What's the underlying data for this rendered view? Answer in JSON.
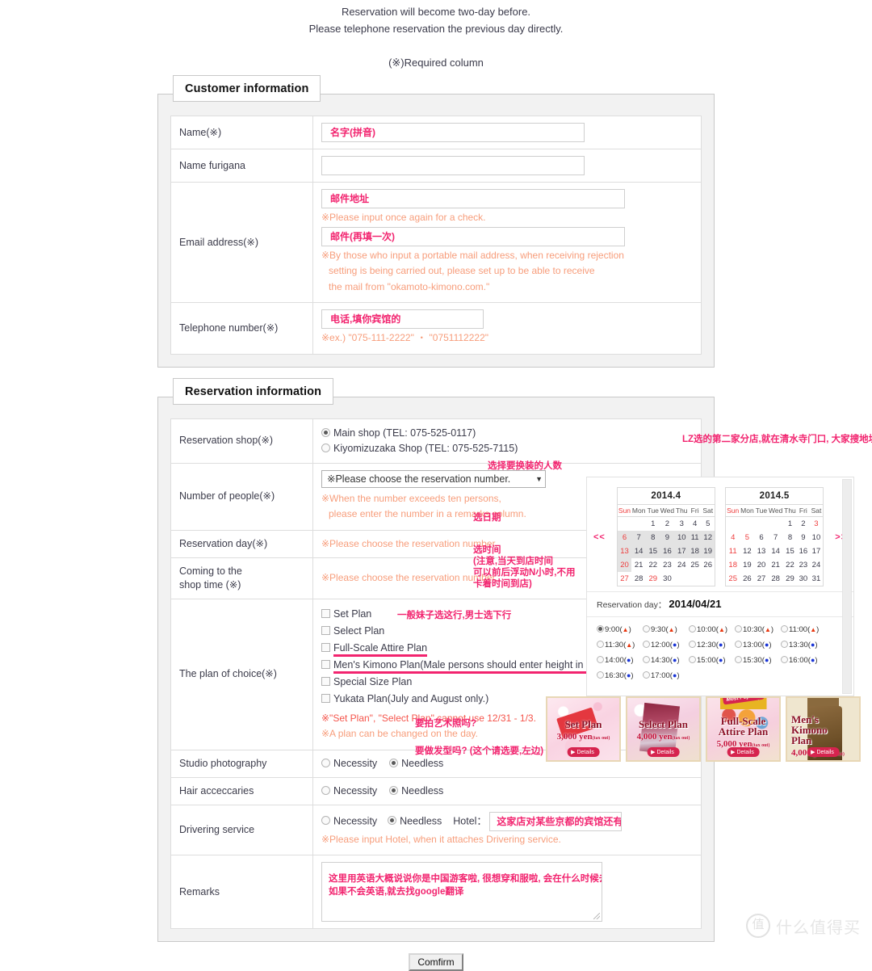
{
  "intro": {
    "line1": "Reservation will become two-day before.",
    "line2": "Please telephone reservation the previous day directly.",
    "required": "(※)Required column"
  },
  "customer_panel": {
    "title": "Customer information",
    "rows": {
      "name_label": "Name(※)",
      "name_value": "名字(拼音)",
      "furigana_label": "Name furigana",
      "furigana_value": "",
      "email_label": "Email address(※)",
      "email_value": "邮件地址",
      "email_check_note": "※Please input once again for a check.",
      "email_confirm_value": "邮件(再填一次)",
      "email_note_1": "※By those who input a portable mail address, when receiving rejection",
      "email_note_2": "setting is being carried out, please set up to be able to receive",
      "email_note_3": "the mail from \"okamoto-kimono.com.\"",
      "tel_label": "Telephone number(※)",
      "tel_value": "电话,填你宾馆的",
      "tel_note": "※ex.)  \"075-111-2222\" ・ \"0751112222\""
    }
  },
  "reservation_panel": {
    "title": "Reservation information",
    "shop": {
      "label": "Reservation shop(※)",
      "option_main": "Main shop (TEL: 075-525-0117)",
      "option_kiyomizu": "Kiyomizuzaka Shop (TEL: 075-525-7115)",
      "annotation": "LZ选的第二家分店,就在清水寺门口, 大家搜地址就在google地图上搜号码就行"
    },
    "people": {
      "label": "Number of people(※)",
      "select_value": "※Please choose the reservation number.",
      "annotation": "选择要换装的人数",
      "note_1": "※When the number exceeds ten persons,",
      "note_2": "please enter the number in a remarks column."
    },
    "day": {
      "label": "Reservation day(※)",
      "note": "※Please choose the reservation number.",
      "annotation": "选日期"
    },
    "time": {
      "label_line1": "Coming to the",
      "label_line2": "shop time (※)",
      "note": "※Please choose the reservation number.",
      "annotation_1": "选时间",
      "annotation_2": "(注意,当天到店时间",
      "annotation_3": "可以前后浮动N小时,不用",
      "annotation_4": "卡着时间到店)"
    },
    "plan": {
      "label": "The plan of choice(※)",
      "items": [
        {
          "text": "Set Plan",
          "underline": false
        },
        {
          "text": "Select Plan",
          "underline": false
        },
        {
          "text": "Full-Scale Attire Plan",
          "underline": true
        },
        {
          "text": "Men's Kimono Plan(Male persons should enter height in a rer",
          "underline": true
        },
        {
          "text": "Special Size Plan",
          "underline": false
        },
        {
          "text": "Yukata Plan(July and August only.)",
          "underline": false
        }
      ],
      "annotation": "一般妹子选这行,男士选下行",
      "note_1": "※\"Set Plan\", \"Select Plan\" cannot use 12/31 - 1/3.",
      "note_2": "※A plan can be changed on the day."
    },
    "studio": {
      "label": "Studio photography",
      "opt_necessity": "Necessity",
      "opt_needless": "Needless",
      "annotation": "要拍艺术照吗?"
    },
    "hair": {
      "label": "Hair acceccaries",
      "opt_necessity": "Necessity",
      "opt_needless": "Needless",
      "annotation": "要做发型吗? (这个请选要,左边)"
    },
    "driver": {
      "label": "Drivering service",
      "opt_necessity": "Necessity",
      "opt_needless": "Needless",
      "hotel_label": "Hotel：",
      "hotel_value": "这家店对某些京都的宾馆还有接送服务....大家可以不管, 这里不用选)",
      "note": "※Please input Hotel, when it attaches Drivering service."
    },
    "remarks": {
      "label": "Remarks",
      "value_line1": "这里用英语大概说说你是中国游客啦, 很想穿和服啦, 会在什么时候去日本然后会在哪天到店啦, 希望贵店接受你的预约啦....",
      "value_line2": "如果不会英语,就去找google翻译"
    }
  },
  "calendar": {
    "prev_label": "<<",
    "next_label": ">>",
    "dow": [
      "Sun",
      "Mon",
      "Tue",
      "Wed",
      "Thu",
      "Fri",
      "Sat"
    ],
    "months": [
      {
        "title": "2014.4",
        "weeks": [
          [
            {
              "d": ""
            },
            {
              "d": ""
            },
            {
              "d": "1"
            },
            {
              "d": "2"
            },
            {
              "d": "3"
            },
            {
              "d": "4"
            },
            {
              "d": "5"
            }
          ],
          [
            {
              "d": "6",
              "dim": true,
              "sun": true
            },
            {
              "d": "7",
              "dim": true
            },
            {
              "d": "8",
              "dim": true
            },
            {
              "d": "9",
              "dim": true
            },
            {
              "d": "10",
              "dim": true
            },
            {
              "d": "11",
              "dim": true
            },
            {
              "d": "12",
              "dim": true
            }
          ],
          [
            {
              "d": "13",
              "dim": true,
              "sun": true
            },
            {
              "d": "14",
              "dim": true
            },
            {
              "d": "15",
              "dim": true
            },
            {
              "d": "16",
              "dim": true
            },
            {
              "d": "17",
              "dim": true
            },
            {
              "d": "18",
              "dim": true
            },
            {
              "d": "19",
              "dim": true
            }
          ],
          [
            {
              "d": "20",
              "dim": true,
              "sun": true
            },
            {
              "d": "21"
            },
            {
              "d": "22"
            },
            {
              "d": "23"
            },
            {
              "d": "24"
            },
            {
              "d": "25"
            },
            {
              "d": "26"
            }
          ],
          [
            {
              "d": "27",
              "sun": true
            },
            {
              "d": "28"
            },
            {
              "d": "29",
              "sun": true
            },
            {
              "d": "30"
            },
            {
              "d": ""
            },
            {
              "d": ""
            },
            {
              "d": ""
            }
          ]
        ]
      },
      {
        "title": "2014.5",
        "weeks": [
          [
            {
              "d": ""
            },
            {
              "d": ""
            },
            {
              "d": ""
            },
            {
              "d": ""
            },
            {
              "d": "1"
            },
            {
              "d": "2"
            },
            {
              "d": "3",
              "sun": true
            }
          ],
          [
            {
              "d": "4",
              "sun": true
            },
            {
              "d": "5",
              "sun": true
            },
            {
              "d": "6"
            },
            {
              "d": "7"
            },
            {
              "d": "8"
            },
            {
              "d": "9"
            },
            {
              "d": "10"
            }
          ],
          [
            {
              "d": "11",
              "sun": true
            },
            {
              "d": "12"
            },
            {
              "d": "13"
            },
            {
              "d": "14"
            },
            {
              "d": "15"
            },
            {
              "d": "16"
            },
            {
              "d": "17"
            }
          ],
          [
            {
              "d": "18",
              "sun": true
            },
            {
              "d": "19"
            },
            {
              "d": "20"
            },
            {
              "d": "21"
            },
            {
              "d": "22"
            },
            {
              "d": "23"
            },
            {
              "d": "24"
            }
          ],
          [
            {
              "d": "25",
              "sun": true
            },
            {
              "d": "26"
            },
            {
              "d": "27"
            },
            {
              "d": "28"
            },
            {
              "d": "29"
            },
            {
              "d": "30"
            },
            {
              "d": "31"
            }
          ]
        ]
      }
    ],
    "selected_day_label": "Reservation day：",
    "selected_day": "2014/04/21",
    "time_slots": [
      {
        "t": "9:00",
        "mark": "triangle",
        "selected": true
      },
      {
        "t": "9:30",
        "mark": "triangle",
        "selected": false
      },
      {
        "t": "10:00",
        "mark": "triangle",
        "selected": false
      },
      {
        "t": "10:30",
        "mark": "triangle",
        "selected": false
      },
      {
        "t": "11:00",
        "mark": "triangle",
        "selected": false
      },
      {
        "t": "11:30",
        "mark": "triangle",
        "selected": false
      },
      {
        "t": "12:00",
        "mark": "dot",
        "selected": false
      },
      {
        "t": "12:30",
        "mark": "dot",
        "selected": false
      },
      {
        "t": "13:00",
        "mark": "dot",
        "selected": false
      },
      {
        "t": "13:30",
        "mark": "dot",
        "selected": false
      },
      {
        "t": "14:00",
        "mark": "dot",
        "selected": false
      },
      {
        "t": "14:30",
        "mark": "dot",
        "selected": false
      },
      {
        "t": "15:00",
        "mark": "dot",
        "selected": false
      },
      {
        "t": "15:30",
        "mark": "dot",
        "selected": false
      },
      {
        "t": "16:00",
        "mark": "dot",
        "selected": false
      },
      {
        "t": "16:30",
        "mark": "dot",
        "selected": false
      },
      {
        "t": "17:00",
        "mark": "dot",
        "selected": false
      }
    ]
  },
  "banners": [
    {
      "title_1": "Set Plan",
      "title_2": "",
      "price": "3,000 yen",
      "tax": "(tax out)",
      "details": "Details",
      "popular": ""
    },
    {
      "title_1": "Select Plan",
      "title_2": "",
      "price": "4,000 yen",
      "tax": "(tax out)",
      "details": "Details",
      "popular": ""
    },
    {
      "title_1": "Full-Scale",
      "title_2": "Attire Plan",
      "price": "5,000 yen",
      "tax": "(tax out)",
      "details": "Details",
      "popular": "Most Popular!"
    },
    {
      "title_1": "Men's Kimono",
      "title_2": "Plan",
      "price": "4,000 yen",
      "tax": "(tax out)",
      "details": "Details",
      "popular": ""
    }
  ],
  "footer": {
    "confirm": "Comfirm",
    "watermark_mark": "值",
    "watermark_text": "什么值得买"
  },
  "colors": {
    "accent_pink": "#f2246f",
    "note_orange": "#f79d7b",
    "note_red": "#f5544b"
  }
}
